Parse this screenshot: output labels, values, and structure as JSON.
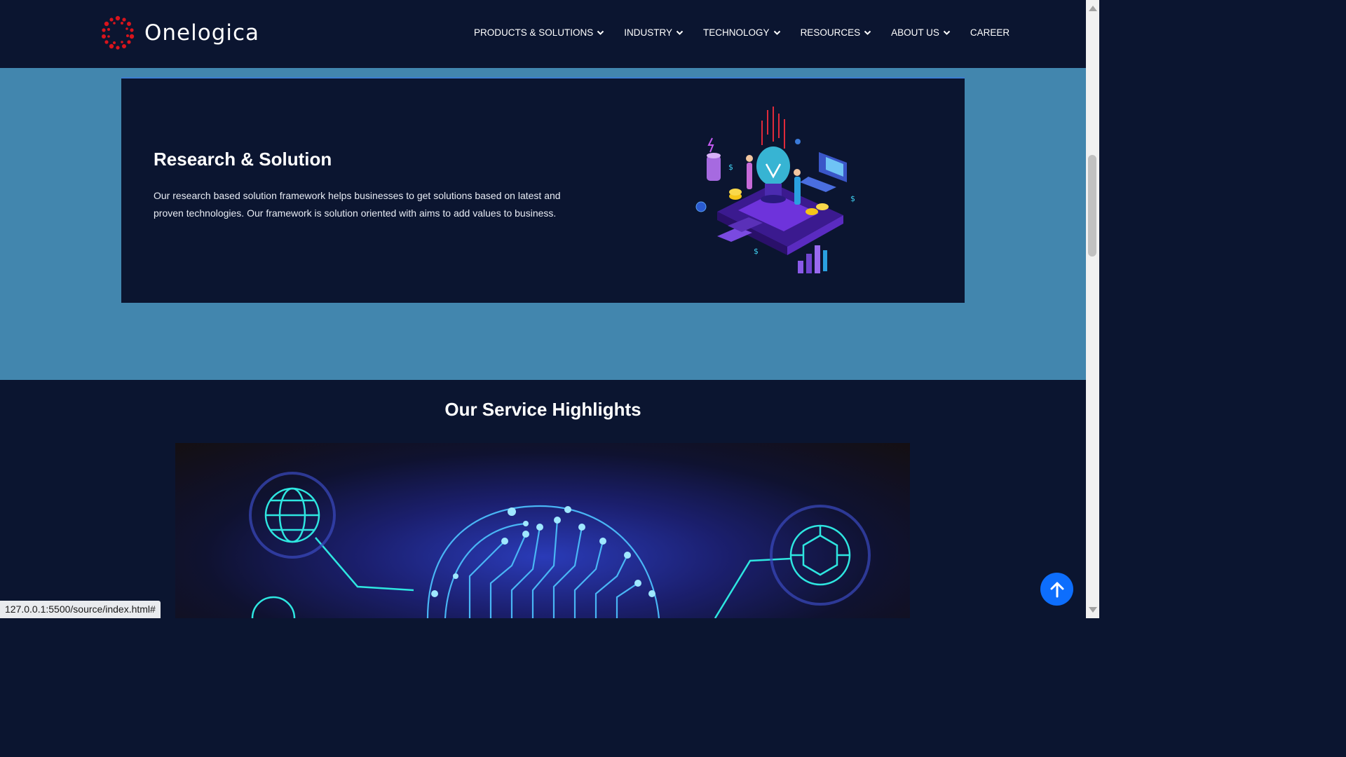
{
  "brand": {
    "name": "Onelogica",
    "logo_icon": "red-dotted-ring-logo"
  },
  "nav": {
    "items": [
      {
        "label": "PRODUCTS & SOLUTIONS",
        "has_dropdown": true
      },
      {
        "label": "INDUSTRY",
        "has_dropdown": true
      },
      {
        "label": "TECHNOLOGY",
        "has_dropdown": true
      },
      {
        "label": "RESOURCES",
        "has_dropdown": true
      },
      {
        "label": "ABOUT US",
        "has_dropdown": true
      },
      {
        "label": "CAREER",
        "has_dropdown": false
      }
    ]
  },
  "research_card": {
    "title": "Research & Solution",
    "description": "Our research based solution framework helps businesses to get solutions based on latest and proven technologies. Our framework is solution oriented with aims to add values to business.",
    "illustration": "isometric-lightbulb-innovation-illustration"
  },
  "services": {
    "title": "Our Service Highlights",
    "image": "ai-circuit-brain-network-image"
  },
  "back_to_top": {
    "icon": "arrow-up-icon"
  },
  "status_bar": {
    "url": "127.0.0.1:5500/source/index.html#"
  },
  "colors": {
    "dark_navy": "#0b1530",
    "section_blue": "#4286ae",
    "accent_blue": "#0d6efd",
    "logo_red": "#d8141c",
    "neon_cyan": "#2ee6e0"
  }
}
